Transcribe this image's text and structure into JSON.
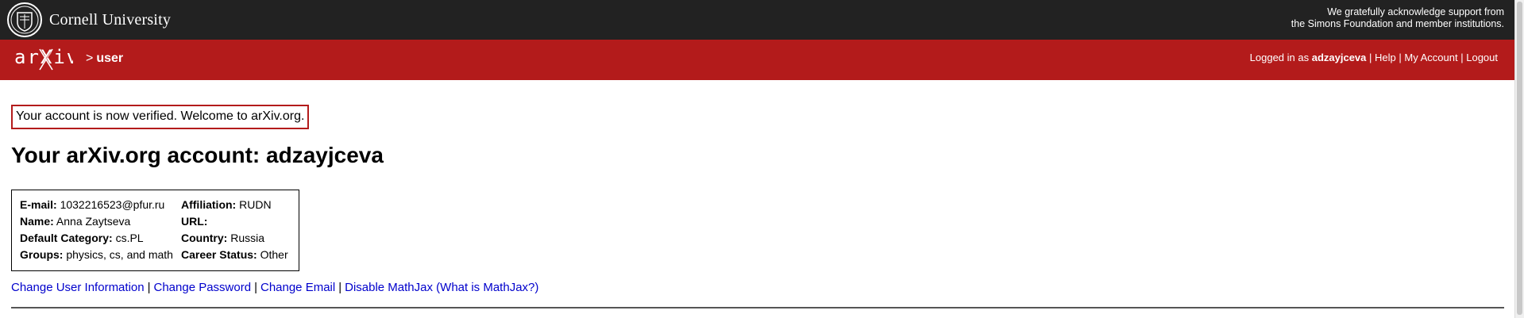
{
  "cornell": {
    "name": "Cornell University",
    "support_line1": "We gratefully acknowledge support from",
    "support_line2": "the Simons Foundation and member institutions."
  },
  "header": {
    "logo_text": "arXiv",
    "crumb_sep": ">",
    "crumb": "user",
    "logged_in_prefix": "Logged in as",
    "username": "adzayjceva",
    "nav": [
      "Help",
      "My Account",
      "Logout"
    ]
  },
  "flash": "Your account is now verified. Welcome to arXiv.org.",
  "title": "Your arXiv.org account: adzayjceva",
  "account": {
    "left": [
      {
        "label": "E-mail:",
        "value": "1032216523@pfur.ru"
      },
      {
        "label": "Name:",
        "value": "Anna Zaytseva"
      },
      {
        "label": "Default Category:",
        "value": "cs.PL"
      },
      {
        "label": "Groups:",
        "value": "physics, cs, and math"
      }
    ],
    "right": [
      {
        "label": "Affiliation:",
        "value": "RUDN"
      },
      {
        "label": "URL:",
        "value": ""
      },
      {
        "label": "Country:",
        "value": "Russia"
      },
      {
        "label": "Career Status:",
        "value": "Other"
      }
    ]
  },
  "links": {
    "change_info": "Change User Information",
    "change_password": "Change Password",
    "change_email": "Change Email",
    "disable_mathjax": "Disable MathJax",
    "what_is_mathjax": "(What is MathJax?)"
  },
  "colors": {
    "cornell_bar": "#222222",
    "arxiv_red": "#b31b1b",
    "link": "#0000cc"
  }
}
